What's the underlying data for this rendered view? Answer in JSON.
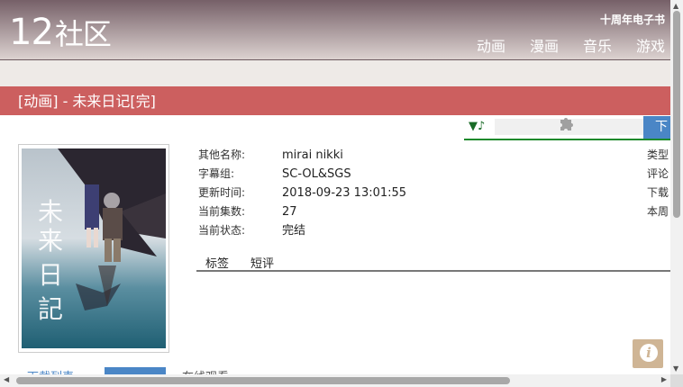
{
  "header": {
    "logo_number": "12",
    "logo_text": "社区",
    "anniversary_link": "十周年电子书",
    "nav": [
      "动画",
      "漫画",
      "音乐",
      "游戏"
    ]
  },
  "title_bar": "[动画] - 未来日记[完]",
  "player": {
    "music_icon": "▼♪",
    "download_label": "下"
  },
  "cover_text": "未来日記",
  "info_rows": [
    {
      "label": "其他名称:",
      "value": "mirai nikki",
      "right_label": "类型"
    },
    {
      "label": "字幕组:",
      "value": "SC-OL&SGS",
      "right_label": "评论"
    },
    {
      "label": "更新时间:",
      "value": "2018-09-23 13:01:55",
      "right_label": "下载"
    },
    {
      "label": "当前集数:",
      "value": "27",
      "right_label": "本周"
    },
    {
      "label": "当前状态:",
      "value": "完结",
      "right_label": ""
    }
  ],
  "tabs": [
    "标签",
    "短评"
  ],
  "bottom_tabs": [
    "下载列表",
    "",
    "在线观看"
  ],
  "colors": {
    "title_bar": "#cc5f5f",
    "accent_blue": "#4a86c6",
    "player_line": "#1d8a2c",
    "info_button": "#cfb595"
  },
  "icons": {
    "puzzle": "puzzle-icon",
    "info": "info-icon"
  }
}
